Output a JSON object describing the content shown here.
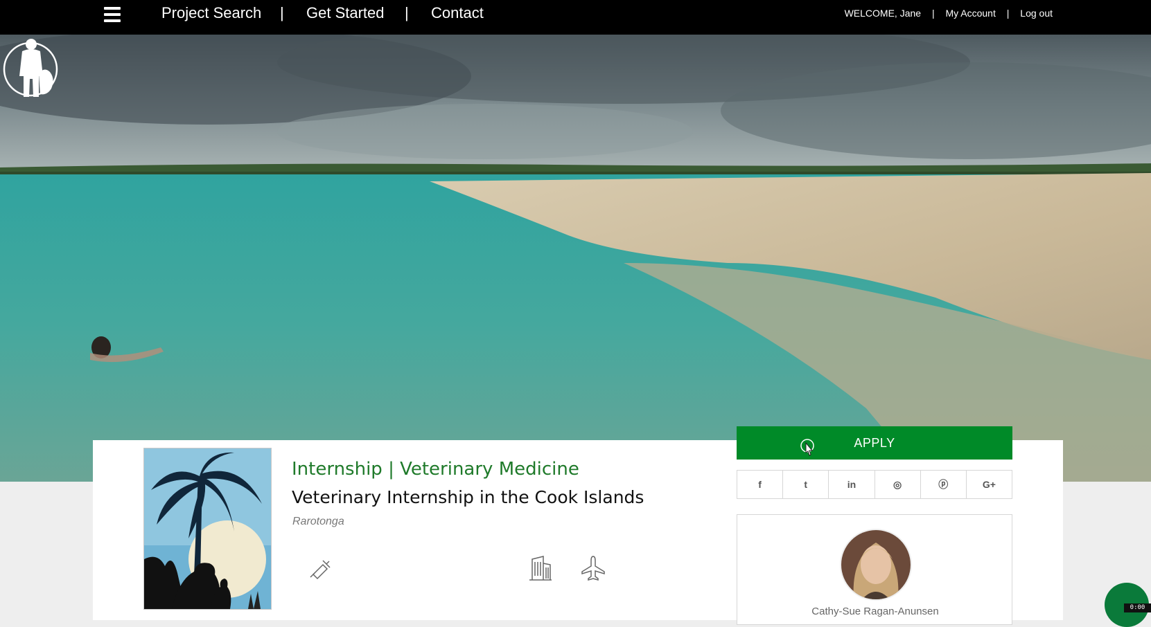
{
  "nav": {
    "links": [
      "Project Search",
      "Get Started",
      "Contact"
    ],
    "separator": "|",
    "welcome": "WELCOME, Jane",
    "my_account": "My Account",
    "logout": "Log out"
  },
  "project": {
    "category": "Internship | Veterinary Medicine",
    "title": "Veterinary Internship in the Cook Islands",
    "location": "Rarotonga",
    "feature_icons": [
      "syringe-icon",
      "building-icon",
      "airplane-icon"
    ]
  },
  "apply_label": "APPLY",
  "share_icons": [
    {
      "name": "facebook-icon",
      "glyph": "f"
    },
    {
      "name": "twitter-icon",
      "glyph": "t"
    },
    {
      "name": "linkedin-icon",
      "glyph": "in"
    },
    {
      "name": "instagram-icon",
      "glyph": "◎"
    },
    {
      "name": "pinterest-icon",
      "glyph": "ⓟ"
    },
    {
      "name": "google-plus-icon",
      "glyph": "G+"
    }
  ],
  "coordinator": {
    "name": "Cathy-Sue Ragan-Anunsen"
  },
  "chat_badge": "0:00",
  "colors": {
    "nav_bg": "#000000",
    "accent_green": "#008a28",
    "category_green": "#1f7a2a"
  }
}
